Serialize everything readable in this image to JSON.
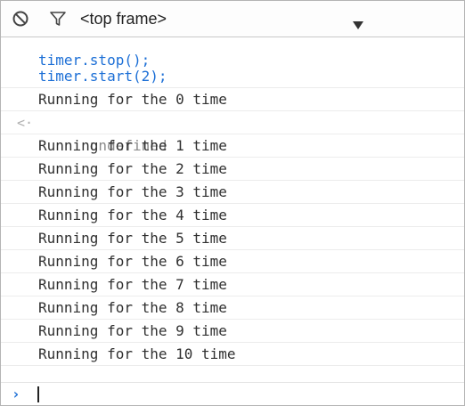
{
  "toolbar": {
    "clear_icon": "clear-console-icon",
    "filter_icon": "filter-icon",
    "frame_label": "<top frame>",
    "dropdown_icon": "chevron-down-icon"
  },
  "log": {
    "commands": [
      "timer.stop();",
      "timer.start(2);"
    ],
    "outputs_before": [
      "Running for the 0 time"
    ],
    "result": "undefined",
    "outputs_after": [
      "Running for the 1 time",
      "Running for the 2 time",
      "Running for the 3 time",
      "Running for the 4 time",
      "Running for the 5 time",
      "Running for the 6 time",
      "Running for the 7 time",
      "Running for the 8 time",
      "Running for the 9 time",
      "Running for the 10 time"
    ]
  },
  "colors": {
    "command": "#1c6fd6",
    "output": "#303030",
    "result": "#8a8a8a",
    "prompt": "#1c6fd6"
  },
  "prompt": {
    "icon": "prompt-chevron-icon",
    "value": ""
  }
}
